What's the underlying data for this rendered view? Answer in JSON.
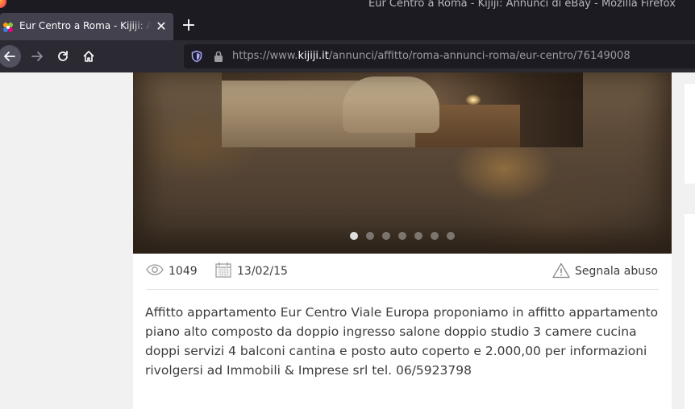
{
  "window": {
    "title": "Eur Centro a Roma - Kijiji: Annunci di eBay - Mozilla Firefox"
  },
  "tab": {
    "title": "Eur Centro a Roma - Kijiji: Annunci di eBay",
    "close_icon": "close-icon"
  },
  "navbar": {
    "url_prefix": "https://www.",
    "url_host": "kijiji.it",
    "url_path": "/annunci/affitto/roma-annunci-roma/eur-centro/76149008"
  },
  "listing": {
    "gallery": {
      "photo_count": 7,
      "active_index": 0
    },
    "views": "1049",
    "date": "13/02/15",
    "report_label": "Segnala abuso",
    "description": "Affitto appartamento Eur Centro Viale Europa proponiamo in affitto appartamento piano alto composto da doppio ingresso salone doppio studio 3 camere cucina doppi servizi 4 balconi cantina e posto auto coperto e 2.000,00 per informazioni rivolgersi ad Immobili & Imprese srl tel. 06/5923798"
  }
}
